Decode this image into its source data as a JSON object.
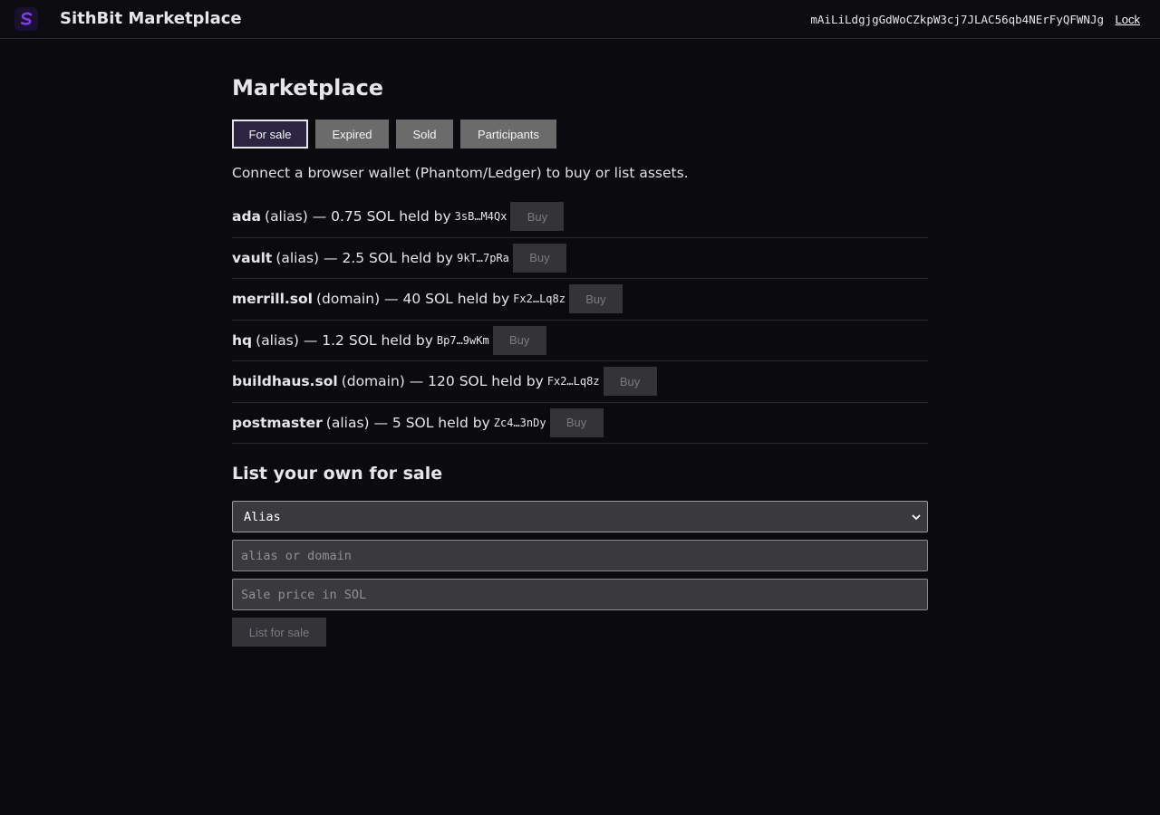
{
  "header": {
    "app_title": "SithBit Marketplace",
    "wallet_address": "mAiLiLdgjgGdWoCZkpW3cj7JLAC56qb4NErFyQFWNJg",
    "lock_label": "Lock",
    "logo_icon": "sithbit-logo-icon",
    "accent_color": "#7b3fe4"
  },
  "main": {
    "title": "Marketplace",
    "tabs": [
      {
        "label": "For sale",
        "active": true
      },
      {
        "label": "Expired",
        "active": false
      },
      {
        "label": "Sold",
        "active": false
      },
      {
        "label": "Participants",
        "active": false
      }
    ],
    "notice": "Connect a browser wallet (Phantom/Ledger) to buy or list assets.",
    "listings": [
      {
        "name": "ada",
        "detail": "(alias) — 0.75 SOL held by",
        "holder": "3sB…M4Qx",
        "buy_label": "Buy"
      },
      {
        "name": "vault",
        "detail": "(alias) — 2.5 SOL held by",
        "holder": "9kT…7pRa",
        "buy_label": "Buy"
      },
      {
        "name": "merrill.sol",
        "detail": "(domain) — 40 SOL held by",
        "holder": "Fx2…Lq8z",
        "buy_label": "Buy"
      },
      {
        "name": "hq",
        "detail": "(alias) — 1.2 SOL held by",
        "holder": "Bp7…9wKm",
        "buy_label": "Buy"
      },
      {
        "name": "buildhaus.sol",
        "detail": "(domain) — 120 SOL held by",
        "holder": "Fx2…Lq8z",
        "buy_label": "Buy"
      },
      {
        "name": "postmaster",
        "detail": "(alias) — 5 SOL held by",
        "holder": "Zc4…3nDy",
        "buy_label": "Buy"
      }
    ]
  },
  "list_form": {
    "title": "List your own for sale",
    "type_select_value": "Alias",
    "name_placeholder": "alias or domain",
    "price_placeholder": "Sale price in SOL",
    "submit_label": "List for sale"
  }
}
